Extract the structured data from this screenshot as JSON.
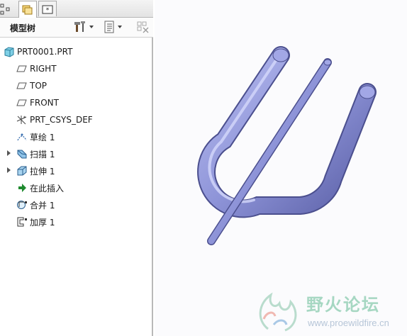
{
  "panel": {
    "title": "模型树"
  },
  "tabs": [
    {
      "name": "model-tree-tab",
      "icon": "folders-icon"
    },
    {
      "name": "layer-tab",
      "icon": "star-layer-icon"
    }
  ],
  "tree": {
    "root": "PRT0001.PRT",
    "items": [
      {
        "label": "RIGHT",
        "icon": "datum-plane-icon"
      },
      {
        "label": "TOP",
        "icon": "datum-plane-icon"
      },
      {
        "label": "FRONT",
        "icon": "datum-plane-icon"
      },
      {
        "label": "PRT_CSYS_DEF",
        "icon": "coordinate-system-icon"
      },
      {
        "label": "草绘 1",
        "icon": "sketch-icon"
      },
      {
        "label": "扫描 1",
        "icon": "sweep-icon",
        "expandable": true
      },
      {
        "label": "拉伸 1",
        "icon": "extrude-icon",
        "expandable": true
      },
      {
        "label": "在此插入",
        "icon": "insert-here-arrow-icon"
      },
      {
        "label": "合并 1",
        "icon": "merge-icon"
      },
      {
        "label": "加厚 1",
        "icon": "thicken-icon"
      }
    ]
  },
  "watermark": {
    "title": "野火论坛",
    "url": "www.proewildfire.cn"
  },
  "colors": {
    "model": "#8e94d8",
    "insert_arrow": "#1e8a2e",
    "watermark_text": "#a6d7c2"
  }
}
